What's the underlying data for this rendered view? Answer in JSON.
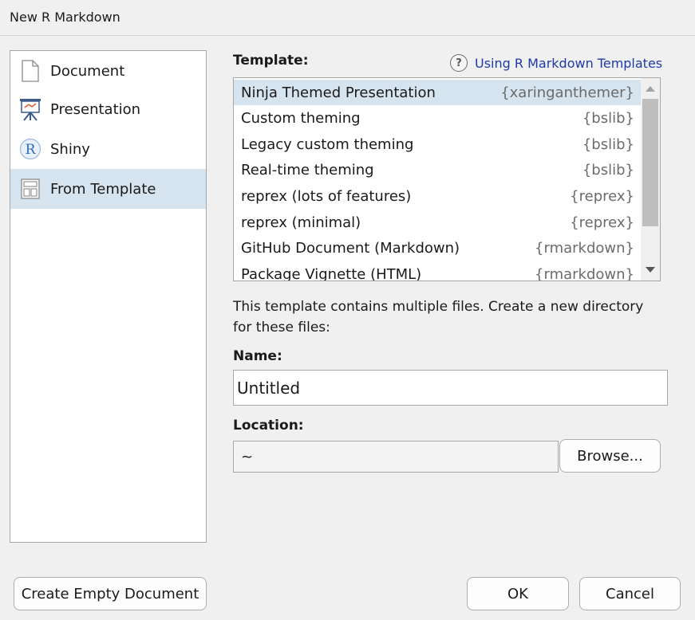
{
  "window": {
    "title": "New R Markdown"
  },
  "sidebar": {
    "items": [
      {
        "label": "Document",
        "icon": "document-icon"
      },
      {
        "label": "Presentation",
        "icon": "presentation-easel-icon"
      },
      {
        "label": "Shiny",
        "icon": "shiny-r-icon"
      },
      {
        "label": "From Template",
        "icon": "template-grid-icon",
        "selected": true
      }
    ]
  },
  "main": {
    "template_label": "Template:",
    "help_link": "Using R Markdown Templates",
    "templates": [
      {
        "name": "Ninja Themed Presentation",
        "package": "{xaringanthemer}",
        "selected": true
      },
      {
        "name": "Custom theming",
        "package": "{bslib}"
      },
      {
        "name": "Legacy custom theming",
        "package": "{bslib}"
      },
      {
        "name": "Real-time theming",
        "package": "{bslib}"
      },
      {
        "name": "reprex (lots of features)",
        "package": "{reprex}"
      },
      {
        "name": "reprex (minimal)",
        "package": "{reprex}"
      },
      {
        "name": "GitHub Document (Markdown)",
        "package": "{rmarkdown}"
      },
      {
        "name": "Package Vignette (HTML)",
        "package": "{rmarkdown}"
      }
    ],
    "description": "This template contains multiple files. Create a new directory for these files:",
    "name_label": "Name:",
    "name_value": "Untitled",
    "location_label": "Location:",
    "location_value": "~",
    "browse_label": "Browse..."
  },
  "footer": {
    "create_empty_label": "Create Empty Document",
    "ok_label": "OK",
    "cancel_label": "Cancel"
  },
  "colors": {
    "selection": "#d6e4f0",
    "link": "#1e3aa8",
    "package_text": "#6b6b6b"
  }
}
